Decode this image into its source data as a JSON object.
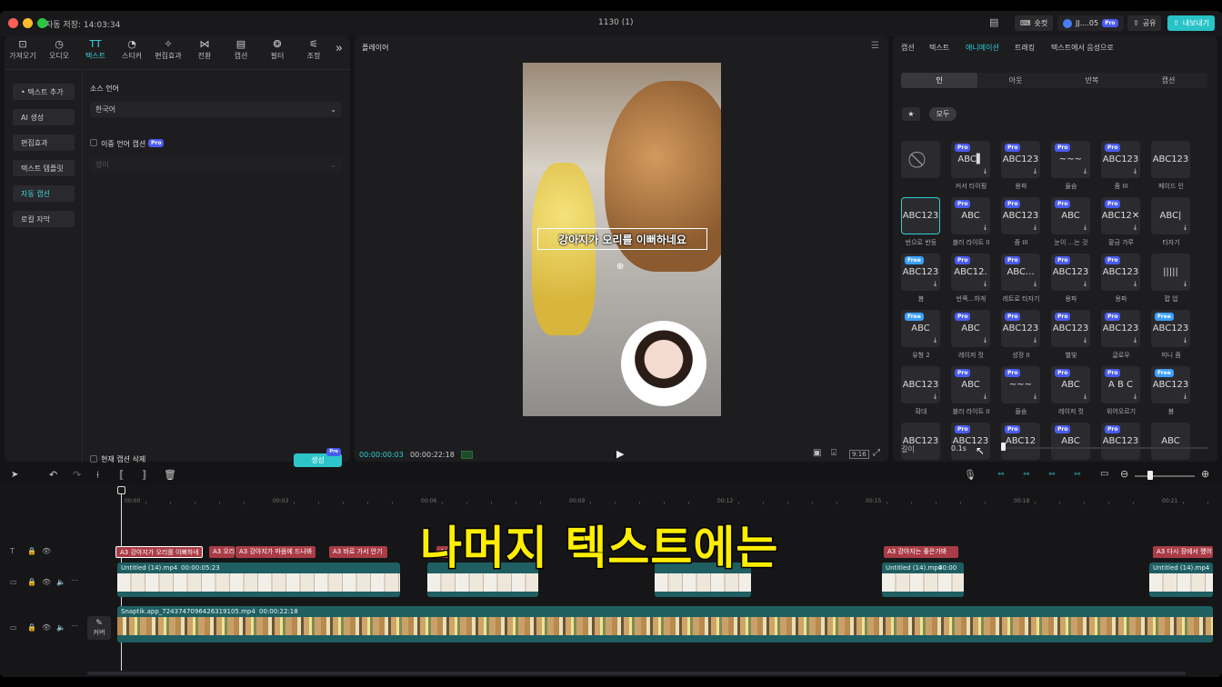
{
  "titlebar": {
    "autosave": "자동 저장: 14:03:34",
    "project": "1130 (1)",
    "shortcut": "숏컷",
    "user": "JJ....05",
    "user_badge": "Pro",
    "share": "공유",
    "export": "내보내기"
  },
  "toolbar": {
    "items": [
      {
        "label": "가져오기",
        "icon": "import-icon"
      },
      {
        "label": "오디오",
        "icon": "audio-icon"
      },
      {
        "label": "텍스트",
        "icon": "text-icon"
      },
      {
        "label": "스티커",
        "icon": "sticker-icon"
      },
      {
        "label": "편집효과",
        "icon": "effects-icon"
      },
      {
        "label": "전환",
        "icon": "transition-icon"
      },
      {
        "label": "캡션",
        "icon": "caption-icon"
      },
      {
        "label": "필터",
        "icon": "filter-icon"
      },
      {
        "label": "조정",
        "icon": "adjust-icon"
      }
    ],
    "more": "»"
  },
  "sidebar": {
    "items": [
      "• 텍스트 추가",
      "AI 생성",
      "편집효과",
      "텍스트 템플릿",
      "자동 캡션",
      "로컬 자막"
    ]
  },
  "caption_panel": {
    "source_lang_label": "소스 언어",
    "source_lang_value": "한국어",
    "bilingual_label": "이중 언어 캡션",
    "bilingual_badge": "Pro",
    "second_lang_placeholder": "영어",
    "delete_current": "현재 캡션 삭제",
    "generate": "생성",
    "generate_badge": "Pro"
  },
  "player": {
    "title": "플레이어",
    "overlay_caption": "강아지가 오리를 이뻐하네요",
    "time_current": "00:00:00:03",
    "time_total": "00:00:22:18",
    "ratio": "9:16"
  },
  "right_panel": {
    "tabs": [
      "캡션",
      "텍스트",
      "애니메이션",
      "트래킹",
      "텍스트에서 음성으로"
    ],
    "active_tab": "애니메이션",
    "subtabs": [
      "인",
      "아웃",
      "반복",
      "캡션"
    ],
    "filters": [
      "★",
      "모두"
    ],
    "duration_label": "길이",
    "duration_value": "0.1s",
    "tiles": [
      {
        "text": "⃠",
        "label": "",
        "badge": "",
        "dl": false
      },
      {
        "text": "ABC▌",
        "label": "커서 타이핑",
        "badge": "Pro",
        "dl": true
      },
      {
        "text": "ABC123",
        "label": "용파",
        "badge": "Pro",
        "dl": true
      },
      {
        "text": "~~~",
        "label": "들숨",
        "badge": "Pro",
        "dl": true
      },
      {
        "text": "ABC123",
        "label": "줌 III",
        "badge": "Pro",
        "dl": true
      },
      {
        "text": "ABC123",
        "label": "페이드 인",
        "badge": "",
        "dl": false
      },
      {
        "text": "ABC123",
        "label": "반으로 반등",
        "badge": "",
        "dl": false
      },
      {
        "text": "ABC",
        "label": "블러 라이트 II",
        "badge": "Pro",
        "dl": true
      },
      {
        "text": "ABC123",
        "label": "줌 III",
        "badge": "Pro",
        "dl": true
      },
      {
        "text": "ABC",
        "label": "눈이 ...는 것",
        "badge": "Pro",
        "dl": true
      },
      {
        "text": "ABC12✕",
        "label": "황금 가루",
        "badge": "Pro",
        "dl": true
      },
      {
        "text": "ABC|",
        "label": "타자기",
        "badge": "",
        "dl": true
      },
      {
        "text": "ABC123",
        "label": "봄",
        "badge": "Free",
        "dl": true
      },
      {
        "text": "ABC12.",
        "label": "반쪽...하게",
        "badge": "Pro",
        "dl": true
      },
      {
        "text": "ABC...",
        "label": "레트로 타자기",
        "badge": "Pro",
        "dl": true
      },
      {
        "text": "ABC123",
        "label": "용파",
        "badge": "Pro",
        "dl": true
      },
      {
        "text": "ABC123",
        "label": "용파",
        "badge": "Pro",
        "dl": true
      },
      {
        "text": "|||||",
        "label": "팝 업",
        "badge": "",
        "dl": true
      },
      {
        "text": "ABC",
        "label": "유형 2",
        "badge": "Free",
        "dl": true
      },
      {
        "text": "ABC",
        "label": "레이저 컷",
        "badge": "Pro",
        "dl": true
      },
      {
        "text": "ABC123",
        "label": "성장 II",
        "badge": "Pro",
        "dl": true
      },
      {
        "text": "ABC123",
        "label": "별빛",
        "badge": "Pro",
        "dl": true
      },
      {
        "text": "ABC123",
        "label": "글로우",
        "badge": "Pro",
        "dl": true
      },
      {
        "text": "ABC123",
        "label": "미니 줌",
        "badge": "Free",
        "dl": true
      },
      {
        "text": "ABC123",
        "label": "확대",
        "badge": "",
        "dl": true
      },
      {
        "text": "ABC",
        "label": "블러 라이트 II",
        "badge": "Pro",
        "dl": true
      },
      {
        "text": "~~~",
        "label": "들숨",
        "badge": "Pro",
        "dl": true
      },
      {
        "text": "ABC",
        "label": "레이저 컷",
        "badge": "Pro",
        "dl": true
      },
      {
        "text": "A B C",
        "label": "위어오르기",
        "badge": "Pro",
        "dl": true
      },
      {
        "text": "ABC123",
        "label": "봄",
        "badge": "Free",
        "dl": true
      },
      {
        "text": "ABC123",
        "label": "",
        "badge": "",
        "dl": false
      },
      {
        "text": "ABC123",
        "label": "",
        "badge": "Pro",
        "dl": false
      },
      {
        "text": "ABC12",
        "label": "",
        "badge": "Pro",
        "dl": false
      },
      {
        "text": "ABC",
        "label": "",
        "badge": "Pro",
        "dl": false
      },
      {
        "text": "ABC123",
        "label": "",
        "badge": "Pro",
        "dl": false
      },
      {
        "text": "ABC",
        "label": "",
        "badge": "",
        "dl": false
      }
    ]
  },
  "timeline": {
    "ruler": [
      "00:00",
      "00:03",
      "00:06",
      "00:09",
      "00:12",
      "00:15",
      "00:18",
      "00:21"
    ],
    "text_clips": [
      {
        "text": "A3 강아지가 오리를 이뻐하네"
      },
      {
        "text": "A3 오리"
      },
      {
        "text": "A3 강아지가 마음에 드나봐"
      },
      {
        "text": "A3 바로 가서 안기"
      },
      {
        "text": "A3 이"
      },
      {
        "text": "A3 강아지는 좋은가봐"
      },
      {
        "text": "A3 다시 장에서 쨌어"
      }
    ],
    "overlay_clips": [
      {
        "name": "Untitled (14).mp4",
        "time": "00:00:05:23"
      },
      {
        "name": "",
        "time": ""
      },
      {
        "name": "",
        "time": ""
      },
      {
        "name": "Untitled (14).mp4",
        "time": "00:00"
      },
      {
        "name": "Untitled (14).mp4",
        "time": ""
      }
    ],
    "main_clip": {
      "name": "Snaptik.app_7243747096426319105.mp4",
      "time": "00:00:22:18"
    },
    "cover_label": "커버"
  },
  "subtitle_overlay": "나머지 텍스트에는"
}
